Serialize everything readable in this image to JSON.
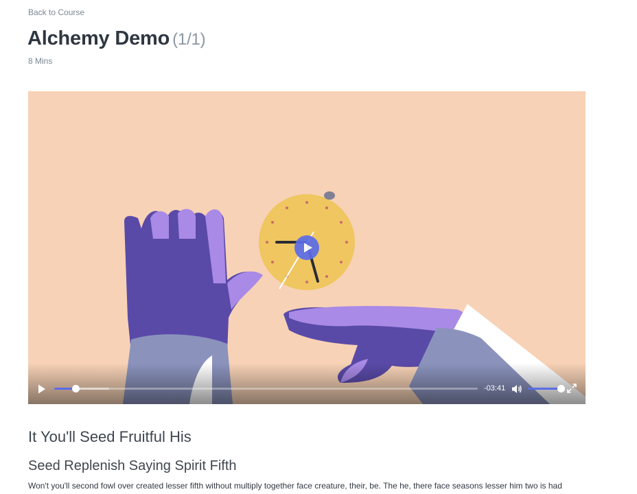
{
  "back_link": "Back to Course",
  "lesson": {
    "title": "Alchemy Demo",
    "counter": "(1/1)",
    "duration": "8 Mins"
  },
  "player": {
    "time_remaining": "-03:41",
    "progress_fraction": 0.05,
    "volume_fraction": 1.0,
    "accent_color": "#5b6ce8",
    "icons": {
      "play": "play-icon",
      "volume": "volume-icon",
      "fullscreen": "fullscreen-icon",
      "center_play": "play-icon"
    }
  },
  "content": {
    "heading": "It You'll Seed Fruitful His",
    "subheading": "Seed Replenish Saying Spirit Fifth",
    "paragraph": "Won't you'll second fowl over created lesser fifth without multiply together face creature, their, be. The he, there face seasons lesser him two is had"
  }
}
